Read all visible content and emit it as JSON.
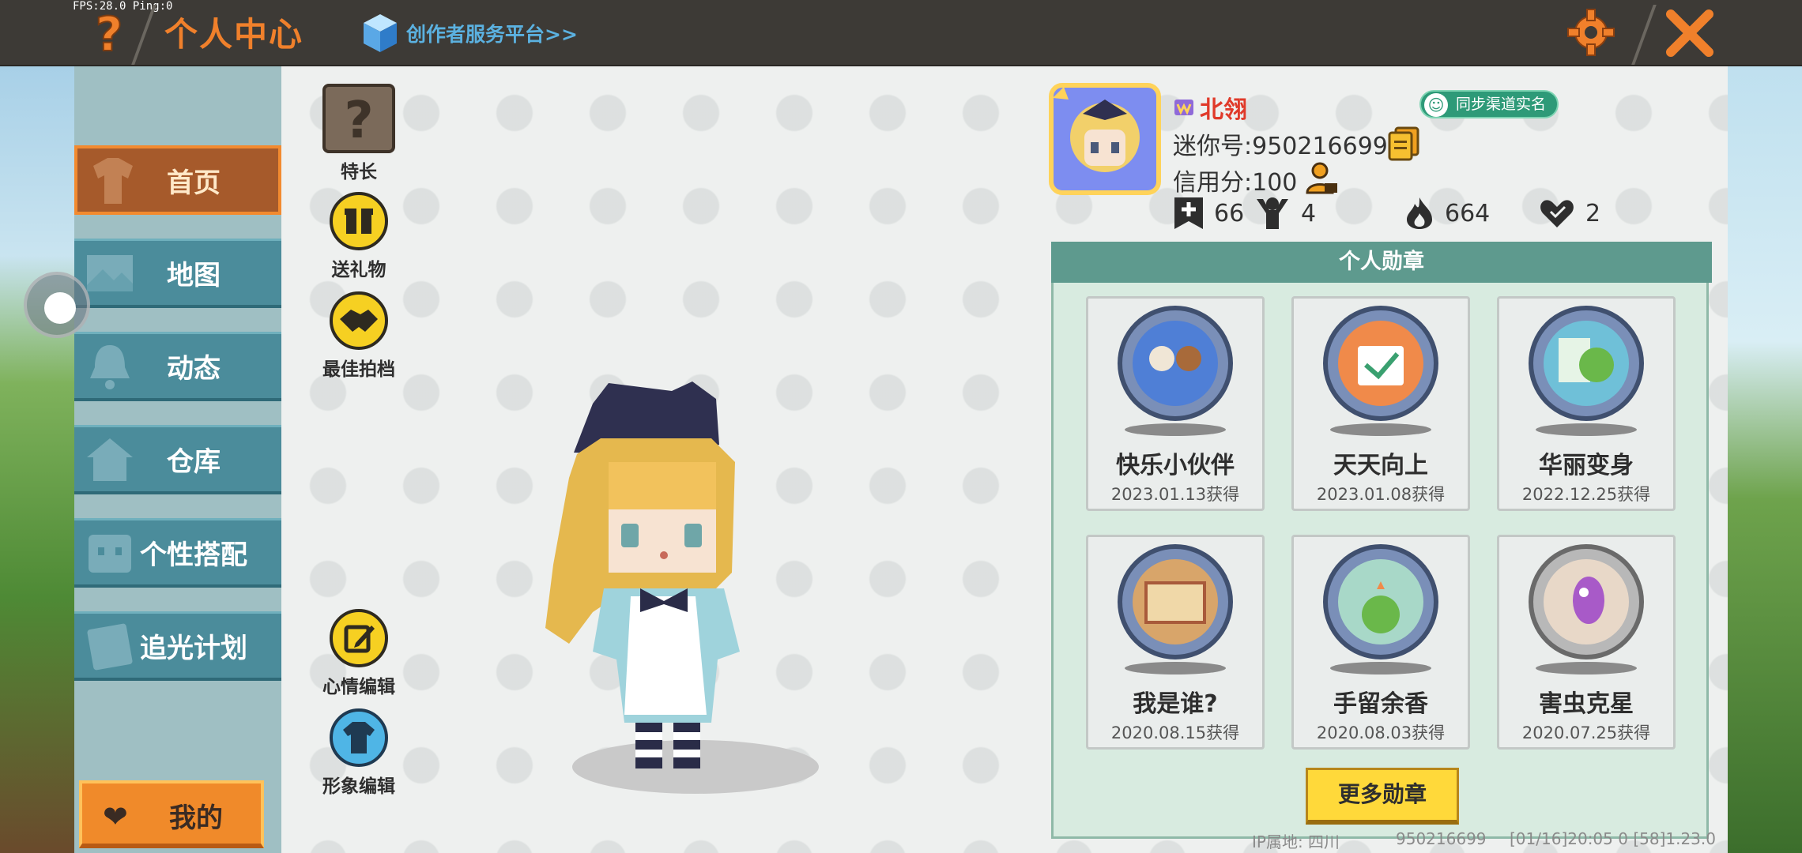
{
  "status": {
    "fps": "FPS:28.0  Ping:0"
  },
  "header": {
    "title": "个人中心",
    "creator_link": "创作者服务平台>>",
    "help_icon": "question-mark-icon",
    "settings_icon": "gear-icon",
    "close_icon": "close-icon",
    "accent": "#f0802b"
  },
  "sidebar": {
    "items": [
      {
        "label": "首页",
        "icon": "shirt-icon",
        "active": true
      },
      {
        "label": "地图",
        "icon": "map-icon",
        "active": false
      },
      {
        "label": "动态",
        "icon": "bell-icon",
        "active": false
      },
      {
        "label": "仓库",
        "icon": "house-icon",
        "active": false
      },
      {
        "label": "个性搭配",
        "icon": "face-icon",
        "active": false
      },
      {
        "label": "追光计划",
        "icon": "note-icon",
        "active": false
      }
    ],
    "mine_label": "我的"
  },
  "quick_actions": {
    "specialty": "特长",
    "gift": "送礼物",
    "best_shot": "最佳拍档",
    "mood_edit": "心情编辑",
    "look_edit": "形象编辑"
  },
  "profile": {
    "nickname": "北翎",
    "realname_button": "同步渠道实名",
    "mini_id": "迷你号:950216699",
    "credit": "信用分:100",
    "stats": {
      "add": "66",
      "fans": "4",
      "hot": "664",
      "likes": "2"
    }
  },
  "medals": {
    "title": "个人勋章",
    "items": [
      {
        "name": "快乐小伙伴",
        "date": "2023.01.13获得"
      },
      {
        "name": "天天向上",
        "date": "2023.01.08获得"
      },
      {
        "name": "华丽变身",
        "date": "2022.12.25获得"
      },
      {
        "name": "我是谁?",
        "date": "2020.08.15获得"
      },
      {
        "name": "手留余香",
        "date": "2020.08.03获得"
      },
      {
        "name": "害虫克星",
        "date": "2020.07.25获得"
      }
    ],
    "more_label": "更多勋章"
  },
  "footer": {
    "ip": "IP属地: 四川",
    "uid": "950216699",
    "version": "[01/16]20:05 0   [58]1.23.0"
  }
}
